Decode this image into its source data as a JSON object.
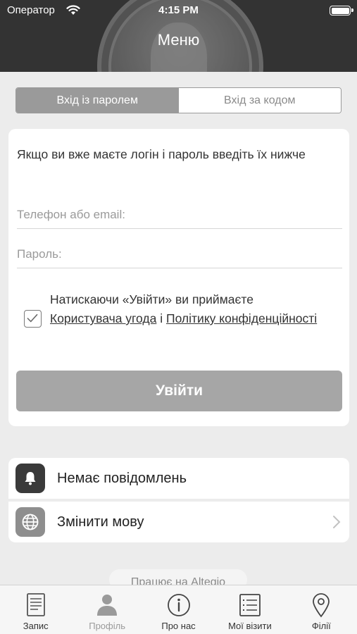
{
  "status_bar": {
    "carrier": "Оператор",
    "time": "4:15 PM"
  },
  "header": {
    "title": "Меню"
  },
  "login_tabs": [
    {
      "label": "Вхід із паролем",
      "active": true
    },
    {
      "label": "Вхід за кодом",
      "active": false
    }
  ],
  "form": {
    "intro": "Якщо ви вже маєте логін і пароль введіть їх нижче",
    "login_placeholder": "Телефон або email:",
    "password_placeholder": "Пароль:",
    "consent_prefix": "Натискаючи «Увійти» ви приймаєте",
    "user_agreement_link": "Користувача угода",
    "consent_and": "і",
    "privacy_link": "Політику конфіденційності",
    "consent_checked": true,
    "submit_label": "Увійти"
  },
  "settings": [
    {
      "label": "Немає повідомлень",
      "icon": "bell-icon"
    },
    {
      "label": "Змінити мову",
      "icon": "globe-icon"
    }
  ],
  "footer": {
    "powered_by": "Працює на Altegio"
  },
  "tabbar": [
    {
      "label": "Запис",
      "icon": "document-icon",
      "active": true
    },
    {
      "label": "Профіль",
      "icon": "person-icon",
      "active": false
    },
    {
      "label": "Про нас",
      "icon": "info-icon",
      "active": true
    },
    {
      "label": "Мої візити",
      "icon": "list-icon",
      "active": true
    },
    {
      "label": "Філії",
      "icon": "location-pin-icon",
      "active": true
    }
  ],
  "colors": {
    "header_bg": "#333333",
    "accent_gray": "#9a9a9a",
    "button_bg": "#a6a6a6",
    "page_bg": "#ececec"
  }
}
